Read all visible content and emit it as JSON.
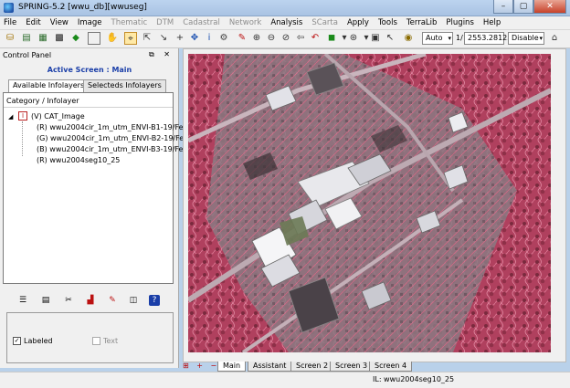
{
  "window": {
    "title": "SPRING-5.2 [wwu_db][wwuseg]",
    "buttons": [
      "–",
      "▢",
      "✕"
    ]
  },
  "menu": [
    {
      "label": "File",
      "enabled": true
    },
    {
      "label": "Edit",
      "enabled": true
    },
    {
      "label": "View",
      "enabled": true
    },
    {
      "label": "Image",
      "enabled": true
    },
    {
      "label": "Thematic",
      "enabled": false
    },
    {
      "label": "DTM",
      "enabled": false
    },
    {
      "label": "Cadastral",
      "enabled": false
    },
    {
      "label": "Network",
      "enabled": false
    },
    {
      "label": "Analysis",
      "enabled": true
    },
    {
      "label": "SCarta",
      "enabled": false
    },
    {
      "label": "Apply",
      "enabled": true
    },
    {
      "label": "Tools",
      "enabled": true
    },
    {
      "label": "TerraLib",
      "enabled": true
    },
    {
      "label": "Plugins",
      "enabled": true
    },
    {
      "label": "Help",
      "enabled": true
    }
  ],
  "toolbar": {
    "zoom_mode": "Auto",
    "scale_prefix": "1/",
    "scale_value": "2553.281250",
    "mode": "Disable"
  },
  "control_panel": {
    "title": "Control Panel",
    "title_buttons": "⧉ ✕",
    "active_screen": "Active Screen : Main",
    "tabs": [
      "Available Infolayers",
      "Selecteds Infolayers"
    ],
    "tree_header": "Category / Infolayer",
    "category": {
      "icon_letter": "I",
      "label": "(V) CAT_Image"
    },
    "layers": [
      "(R) wwu2004cir_1m_utm_ENVI-B1-19/Fe",
      "(G) wwu2004cir_1m_utm_ENVI-B2-19/Fe",
      "(B) wwu2004cir_1m_utm_ENVI-B3-19/Fe",
      "(R) wwu2004seg10_25"
    ],
    "labeled": {
      "label": "Labeled",
      "checked": true
    },
    "text": {
      "label": "Text",
      "checked": false
    }
  },
  "screen_tabs": [
    "Main",
    "Assistant",
    "Screen 2",
    "Screen 3",
    "Screen 4"
  ],
  "status": {
    "text": "IL: wwu2004seg10_25"
  },
  "colors": {
    "map_base": "#b44a66",
    "selection_highlight": "#ffe9a6",
    "active_screen_text": "#1a3ea8"
  }
}
